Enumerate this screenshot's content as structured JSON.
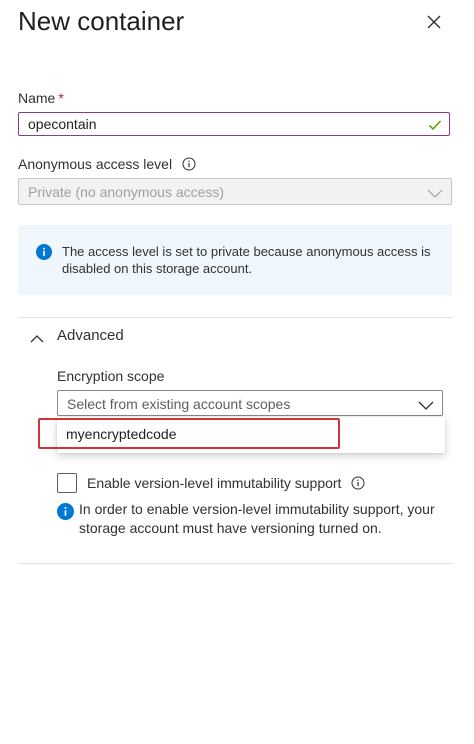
{
  "header": {
    "title": "New container"
  },
  "name_field": {
    "label": "Name",
    "required_mark": "*",
    "value": "opecontain"
  },
  "access_level": {
    "label": "Anonymous access level",
    "selected": "Private (no anonymous access)"
  },
  "banner": {
    "text": "The access level is set to private because anonymous access is disabled on this storage account."
  },
  "advanced": {
    "label": "Advanced",
    "encryption_scope": {
      "label": "Encryption scope",
      "placeholder": "Select from existing account scopes",
      "options": [
        "myencryptedcode"
      ]
    },
    "immutability": {
      "checkbox_label": "Enable version-level immutability support",
      "checked": false,
      "info_text": "In order to enable version-level immutability support, your storage account must have versioning turned on."
    }
  },
  "colors": {
    "accent": "#0078d4",
    "valid_check": "#57a300",
    "input_focus_border": "#8a3a8f",
    "highlight_box": "#d13438",
    "banner_bg": "#eff6fc"
  }
}
